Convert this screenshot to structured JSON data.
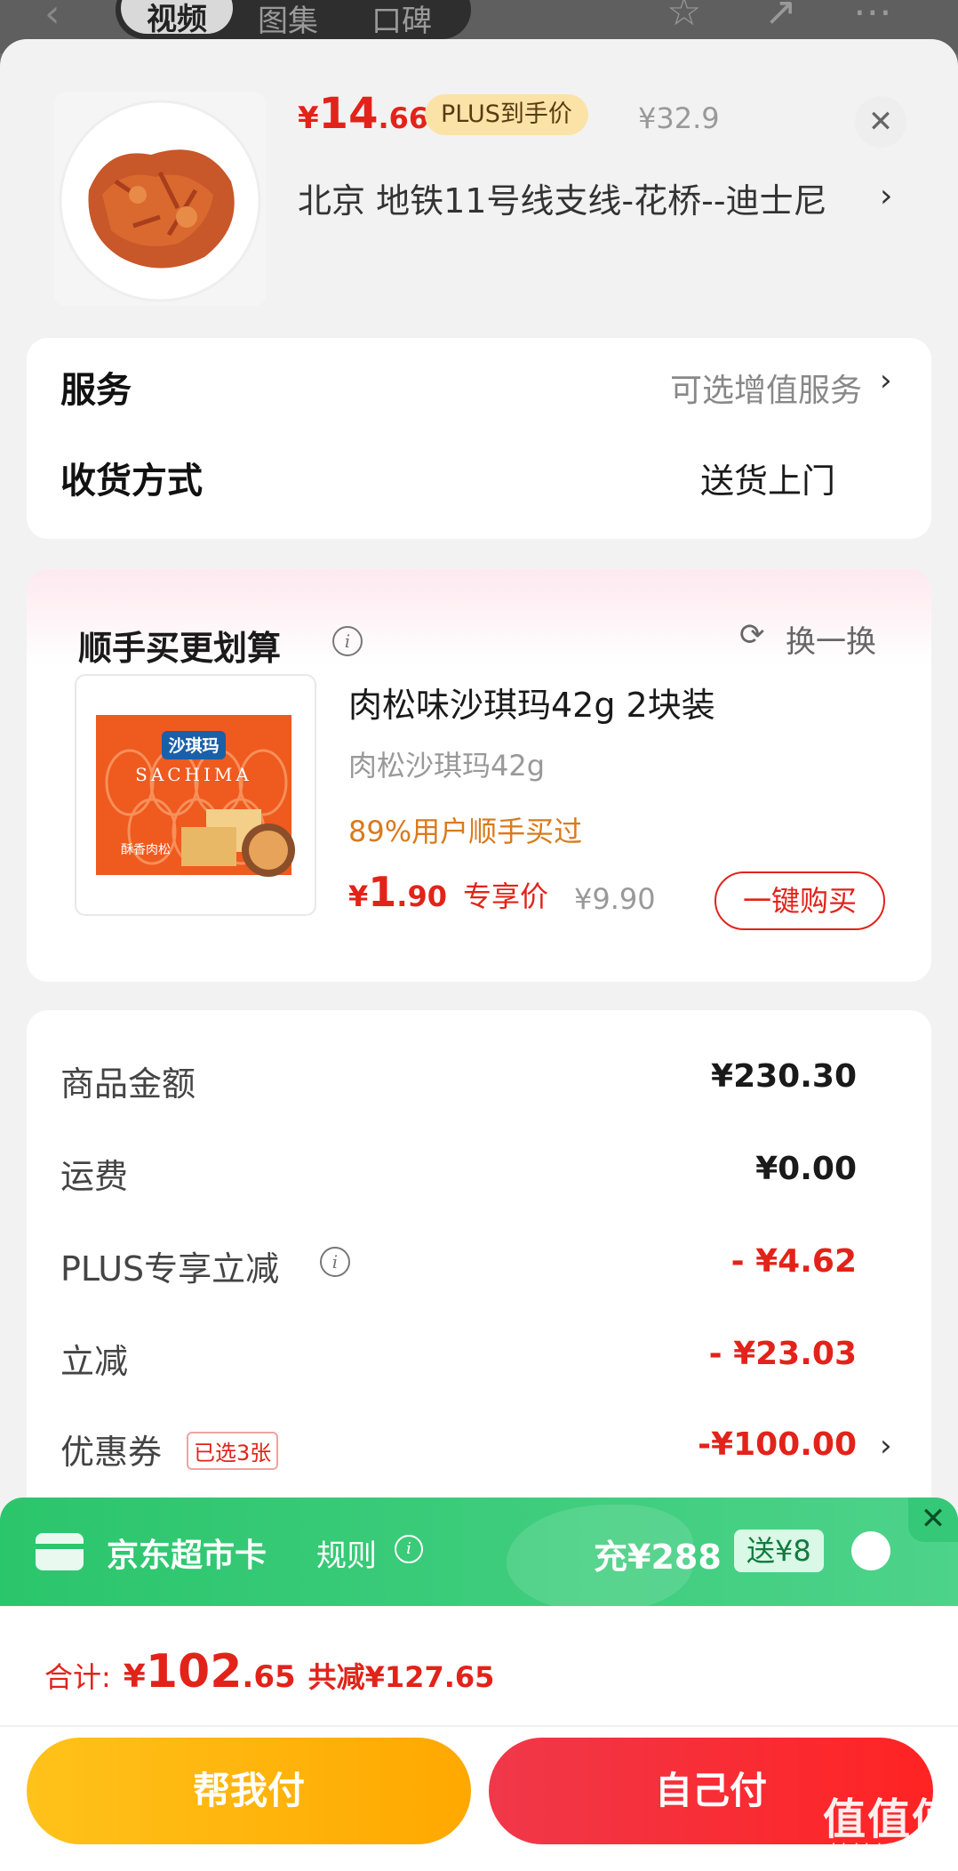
{
  "top_bar": {
    "tabs": [
      "视频",
      "图集",
      "口碑"
    ],
    "back_icon": "back-arrow-icon",
    "icons": [
      "star-icon",
      "share-icon",
      "more-icon"
    ]
  },
  "product": {
    "price_symbol": "¥",
    "price_int": "14",
    "price_dec": ".66",
    "plus_label": "PLUS到手价",
    "original_price": "¥32.9",
    "address": "北京  地铁11号线支线-花桥--迪士尼",
    "chevron": "›",
    "close": "✕"
  },
  "service": {
    "label": "服务",
    "value": "可选增值服务",
    "chevron": "›"
  },
  "delivery": {
    "label": "收货方式",
    "value": "送货上门"
  },
  "combo": {
    "title": "顺手买更划算",
    "refresh_label": "换一换",
    "image": {
      "brand": "沙琪玛",
      "brand_en": "SACHIMA",
      "flavor": "酥香肉松"
    },
    "item": {
      "name": "肉松味沙琪玛42g 2块装",
      "subtitle": "肉松沙琪玛42g",
      "purchase_rate": "89%用户顺手买过",
      "price_symbol": "¥",
      "price_int": "1",
      "price_dec": ".90",
      "price_tag": "专享价",
      "original_price": "¥9.90",
      "buy_label": "一键购买"
    }
  },
  "totals": {
    "rows": [
      {
        "label": "商品金额",
        "value": "¥230.30",
        "color": "#1a1a1a"
      },
      {
        "label": "运费",
        "value": "¥0.00",
        "color": "#1a1a1a"
      },
      {
        "label": "PLUS专享立减",
        "value": "- ¥4.62",
        "color": "#e2231a"
      },
      {
        "label": "立减",
        "value": "- ¥23.03",
        "color": "#e2231a"
      },
      {
        "label": "优惠券",
        "value": "-¥100.00",
        "color": "#e2231a"
      }
    ],
    "coupon_tag": "已选3张"
  },
  "supermarket_card": {
    "title": "京东超市卡",
    "rule": "规则",
    "charge": "充¥288",
    "gift": "送¥8",
    "close": "✕"
  },
  "bottom": {
    "total_label": "合计:",
    "total_symbol": "¥",
    "total_int": "102",
    "total_dec": ".65",
    "saved": "共减¥127.65",
    "help_pay": "帮我付",
    "self_pay": "自己付",
    "watermark": "值值值",
    "watermark_url": "zhizhizhi.com"
  },
  "colors": {
    "accent_red": "#e2231a",
    "plus_gold": "#fbe3a8",
    "green_bar": "#2bc56c",
    "help_btn": "#ffb400",
    "self_btn": "#f0384a"
  }
}
